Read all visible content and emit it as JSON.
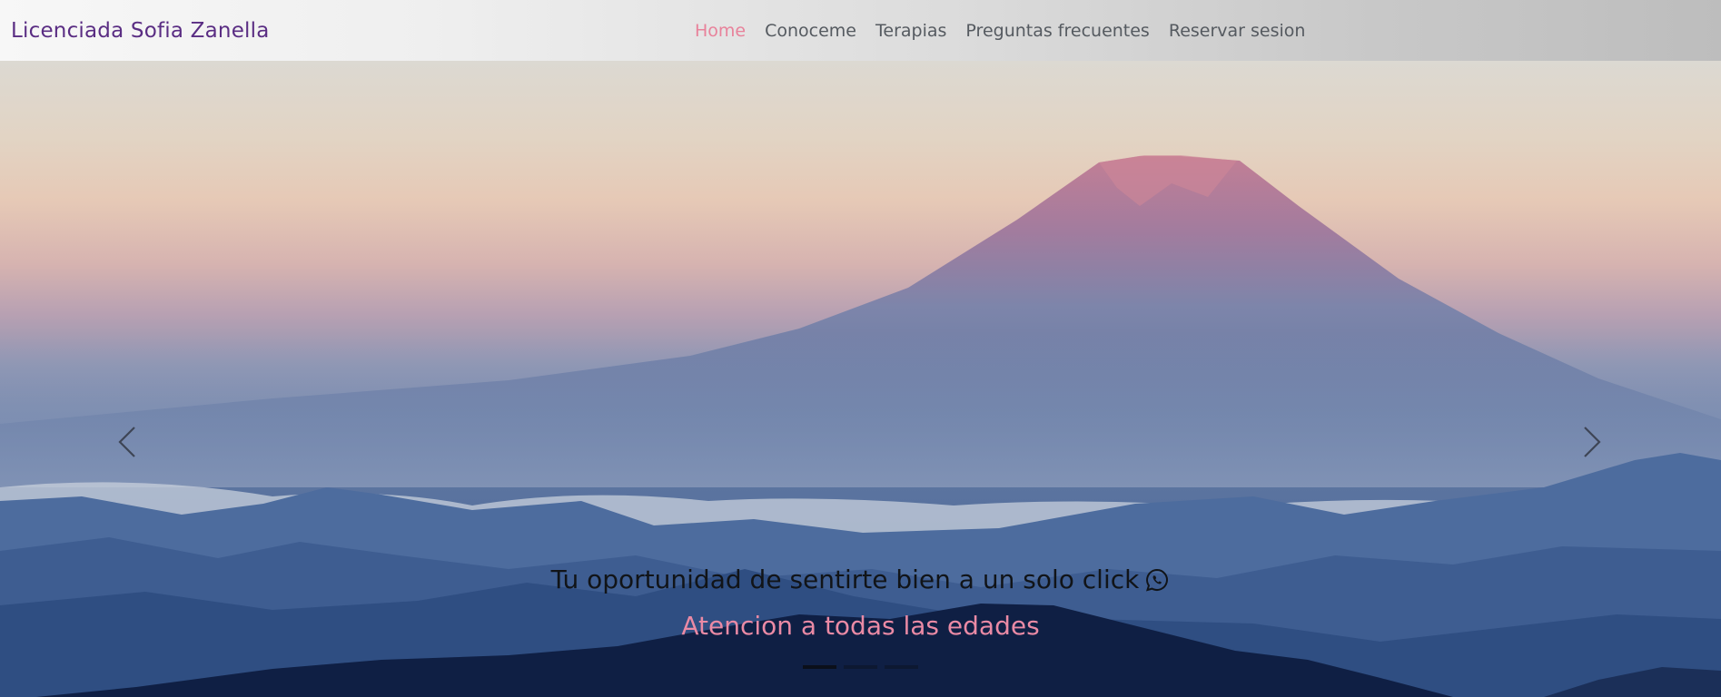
{
  "navbar": {
    "brand": "Licenciada Sofia Zanella",
    "links": [
      {
        "label": "Home",
        "active": true
      },
      {
        "label": "Conoceme",
        "active": false
      },
      {
        "label": "Terapias",
        "active": false
      },
      {
        "label": "Preguntas frecuentes",
        "active": false
      },
      {
        "label": "Reservar sesion",
        "active": false
      }
    ]
  },
  "hero": {
    "caption_title": "Tu oportunidad de sentirte bien a un solo click",
    "caption_icon": "whatsapp-icon",
    "caption_subtitle": "Atencion a todas las edades",
    "slide_count": 3,
    "active_slide": 1,
    "prev_icon": "chevron-left-icon",
    "next_icon": "chevron-right-icon"
  },
  "colors": {
    "brand": "#5a2d83",
    "active_link": "#e8829b",
    "link": "#555a60",
    "subtitle": "#ea8aa5"
  }
}
